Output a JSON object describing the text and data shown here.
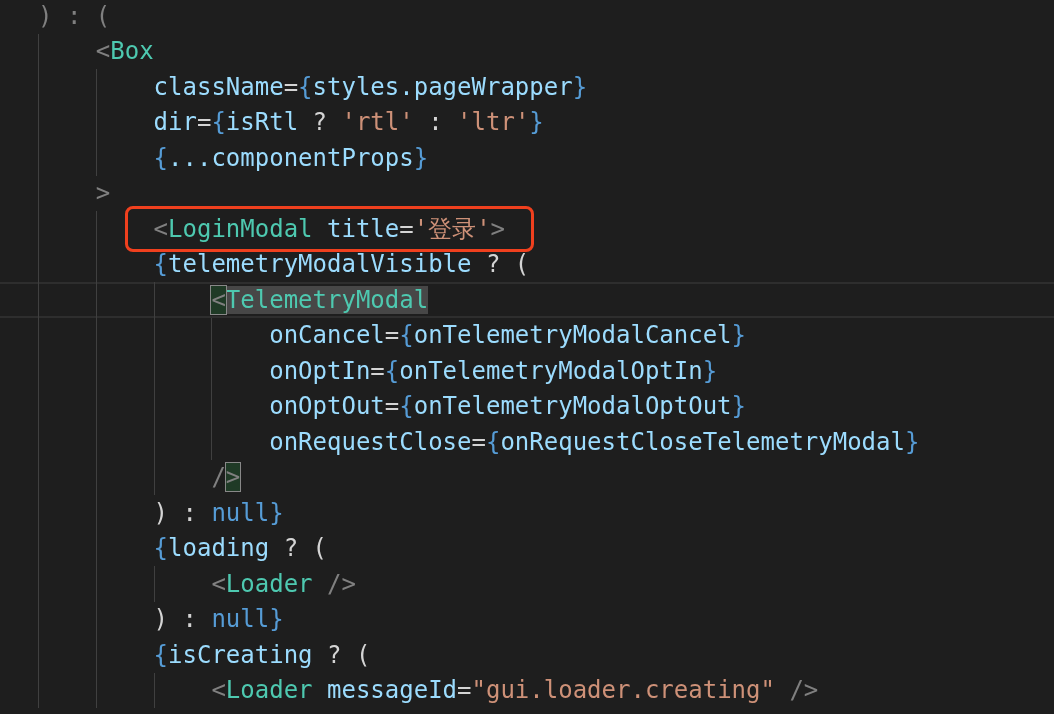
{
  "editor": {
    "lines": [
      {
        "boxed": false,
        "current": false,
        "tokens": [
          {
            "kind": "punct",
            "text": ") : ("
          }
        ],
        "children": [
          {
            "boxed": false,
            "current": false,
            "tokens": [
              {
                "kind": "punct",
                "text": "<"
              },
              {
                "kind": "tag",
                "text": "Box"
              }
            ],
            "children": [
              {
                "boxed": false,
                "current": false,
                "tokens": [
                  {
                    "kind": "attr",
                    "text": "className"
                  },
                  {
                    "kind": "op",
                    "text": "="
                  },
                  {
                    "kind": "brace",
                    "text": "{"
                  },
                  {
                    "kind": "var",
                    "text": "styles.pageWrapper"
                  },
                  {
                    "kind": "brace",
                    "text": "}"
                  }
                ]
              },
              {
                "boxed": false,
                "current": false,
                "tokens": [
                  {
                    "kind": "attr",
                    "text": "dir"
                  },
                  {
                    "kind": "op",
                    "text": "="
                  },
                  {
                    "kind": "brace",
                    "text": "{"
                  },
                  {
                    "kind": "var",
                    "text": "isRtl"
                  },
                  {
                    "kind": "op",
                    "text": " ? "
                  },
                  {
                    "kind": "string",
                    "text": "'rtl'"
                  },
                  {
                    "kind": "op",
                    "text": " : "
                  },
                  {
                    "kind": "string",
                    "text": "'ltr'"
                  },
                  {
                    "kind": "brace",
                    "text": "}"
                  }
                ]
              },
              {
                "boxed": false,
                "current": false,
                "tokens": [
                  {
                    "kind": "brace",
                    "text": "{"
                  },
                  {
                    "kind": "var",
                    "text": "...componentProps"
                  },
                  {
                    "kind": "brace",
                    "text": "}"
                  }
                ]
              }
            ]
          },
          {
            "boxed": false,
            "current": false,
            "tokens": [
              {
                "kind": "punct",
                "text": ">"
              }
            ],
            "children": [
              {
                "boxed": true,
                "current": false,
                "tokens": [
                  {
                    "kind": "punct",
                    "text": "<"
                  },
                  {
                    "kind": "tag",
                    "text": "LoginModal"
                  },
                  {
                    "kind": "attr",
                    "text": " title"
                  },
                  {
                    "kind": "op",
                    "text": "="
                  },
                  {
                    "kind": "string",
                    "text": "'登录'"
                  },
                  {
                    "kind": "punct",
                    "text": ">"
                  }
                ]
              },
              {
                "boxed": false,
                "current": false,
                "tokens": [
                  {
                    "kind": "brace",
                    "text": "{"
                  },
                  {
                    "kind": "var",
                    "text": "telemetryModalVisible"
                  },
                  {
                    "kind": "op",
                    "text": " ? ("
                  }
                ],
                "children": [
                  {
                    "boxed": false,
                    "current": true,
                    "tokens": [
                      {
                        "kind": "match",
                        "text": "<"
                      },
                      {
                        "kind": "selected-tag",
                        "text": "TelemetryModal"
                      }
                    ],
                    "children": [
                      {
                        "boxed": false,
                        "current": false,
                        "tokens": [
                          {
                            "kind": "attr",
                            "text": "onCancel"
                          },
                          {
                            "kind": "op",
                            "text": "="
                          },
                          {
                            "kind": "brace",
                            "text": "{"
                          },
                          {
                            "kind": "var",
                            "text": "onTelemetryModalCancel"
                          },
                          {
                            "kind": "brace",
                            "text": "}"
                          }
                        ]
                      },
                      {
                        "boxed": false,
                        "current": false,
                        "tokens": [
                          {
                            "kind": "attr",
                            "text": "onOptIn"
                          },
                          {
                            "kind": "op",
                            "text": "="
                          },
                          {
                            "kind": "brace",
                            "text": "{"
                          },
                          {
                            "kind": "var",
                            "text": "onTelemetryModalOptIn"
                          },
                          {
                            "kind": "brace",
                            "text": "}"
                          }
                        ]
                      },
                      {
                        "boxed": false,
                        "current": false,
                        "tokens": [
                          {
                            "kind": "attr",
                            "text": "onOptOut"
                          },
                          {
                            "kind": "op",
                            "text": "="
                          },
                          {
                            "kind": "brace",
                            "text": "{"
                          },
                          {
                            "kind": "var",
                            "text": "onTelemetryModalOptOut"
                          },
                          {
                            "kind": "brace",
                            "text": "}"
                          }
                        ]
                      },
                      {
                        "boxed": false,
                        "current": false,
                        "tokens": [
                          {
                            "kind": "attr",
                            "text": "onRequestClose"
                          },
                          {
                            "kind": "op",
                            "text": "="
                          },
                          {
                            "kind": "brace",
                            "text": "{"
                          },
                          {
                            "kind": "var",
                            "text": "onRequestCloseTelemetryModal"
                          },
                          {
                            "kind": "brace",
                            "text": "}"
                          }
                        ]
                      }
                    ]
                  },
                  {
                    "boxed": false,
                    "current": false,
                    "tokens": [
                      {
                        "kind": "punct",
                        "text": "/"
                      },
                      {
                        "kind": "match",
                        "text": ">"
                      }
                    ]
                  }
                ]
              },
              {
                "boxed": false,
                "current": false,
                "tokens": [
                  {
                    "kind": "op",
                    "text": ") : "
                  },
                  {
                    "kind": "keyword",
                    "text": "null"
                  },
                  {
                    "kind": "brace",
                    "text": "}"
                  }
                ]
              },
              {
                "boxed": false,
                "current": false,
                "tokens": [
                  {
                    "kind": "brace",
                    "text": "{"
                  },
                  {
                    "kind": "var",
                    "text": "loading"
                  },
                  {
                    "kind": "op",
                    "text": " ? ("
                  }
                ],
                "children": [
                  {
                    "boxed": false,
                    "current": false,
                    "tokens": [
                      {
                        "kind": "punct",
                        "text": "<"
                      },
                      {
                        "kind": "tag",
                        "text": "Loader"
                      },
                      {
                        "kind": "punct",
                        "text": " />"
                      }
                    ]
                  }
                ]
              },
              {
                "boxed": false,
                "current": false,
                "tokens": [
                  {
                    "kind": "op",
                    "text": ") : "
                  },
                  {
                    "kind": "keyword",
                    "text": "null"
                  },
                  {
                    "kind": "brace",
                    "text": "}"
                  }
                ]
              },
              {
                "boxed": false,
                "current": false,
                "tokens": [
                  {
                    "kind": "brace",
                    "text": "{"
                  },
                  {
                    "kind": "var",
                    "text": "isCreating"
                  },
                  {
                    "kind": "op",
                    "text": " ? ("
                  }
                ],
                "children": [
                  {
                    "boxed": false,
                    "current": false,
                    "tokens": [
                      {
                        "kind": "punct",
                        "text": "<"
                      },
                      {
                        "kind": "tag",
                        "text": "Loader"
                      },
                      {
                        "kind": "attr",
                        "text": " messageId"
                      },
                      {
                        "kind": "op",
                        "text": "="
                      },
                      {
                        "kind": "string",
                        "text": "\"gui.loader.creating\""
                      },
                      {
                        "kind": "punct",
                        "text": " />"
                      }
                    ]
                  }
                ]
              }
            ]
          }
        ]
      }
    ]
  }
}
